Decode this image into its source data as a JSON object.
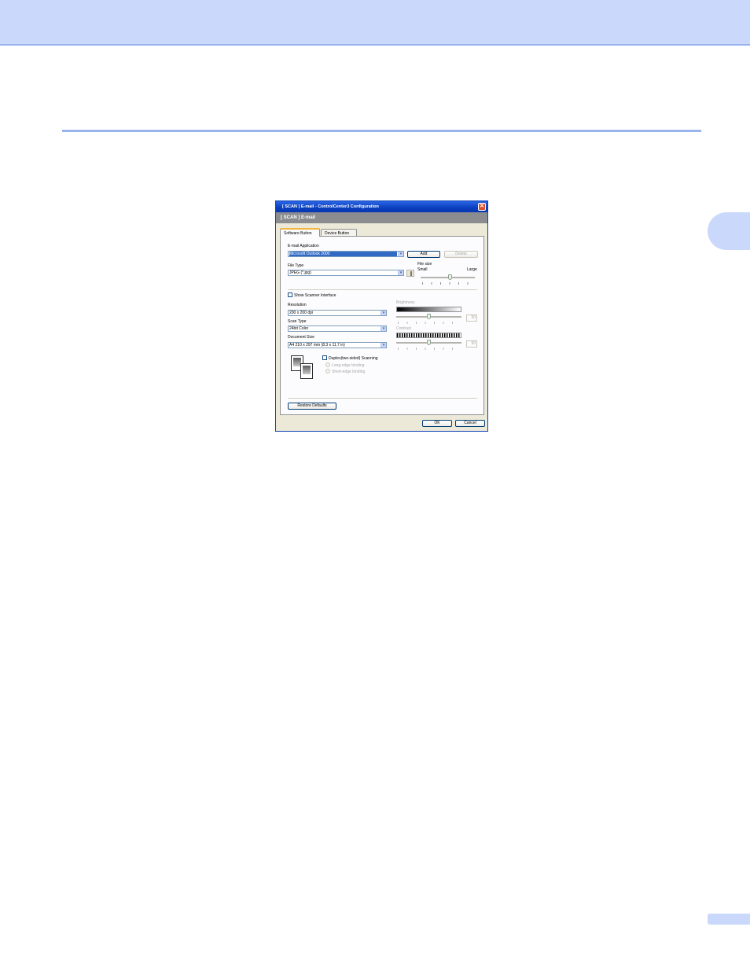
{
  "dialog": {
    "title": "[  SCAN  ]    E-mail - ControlCenter3 Configuration",
    "close_glyph": "✕",
    "header": "[  SCAN  ]   E-mail",
    "tabs": [
      {
        "label": "Software Button",
        "active": true
      },
      {
        "label": "Device Button",
        "active": false
      }
    ],
    "email_app": {
      "label": "E-mail Application",
      "value": "Microsoft Outlook 2000",
      "add_label": "Add",
      "delete_label": "Delete"
    },
    "file_type": {
      "label": "File Type",
      "value": "JPEG (*.jpg)"
    },
    "file_size": {
      "label": "File size",
      "small_label": "Small",
      "large_label": "Large",
      "level": 0.55
    },
    "show_scanner_interface": {
      "label": "Show Scanner Interface",
      "checked": false
    },
    "resolution": {
      "label": "Resolution",
      "value": "200 x 200 dpi"
    },
    "scan_type": {
      "label": "Scan Type",
      "value": "24bit Color"
    },
    "document_size": {
      "label": "Document Size",
      "value": "A4 210 x 297 mm (8.3 x 11.7 in)"
    },
    "brightness": {
      "label": "Brightness",
      "value": "50"
    },
    "contrast": {
      "label": "Contrast",
      "value": "50"
    },
    "duplex": {
      "label": "Duplex(two-sided) Scanning",
      "checked": false,
      "options": [
        "Long-edge binding",
        "Short-edge binding"
      ]
    },
    "restore_label": "Restore Defaults",
    "ok_label": "OK",
    "cancel_label": "Cancel",
    "dropdown_glyph": "▾",
    "colors": {
      "titlebar": "#0a3fbe",
      "header": "#8a8c90",
      "selection": "#316ac5",
      "page_band": "#cad9fb"
    }
  }
}
